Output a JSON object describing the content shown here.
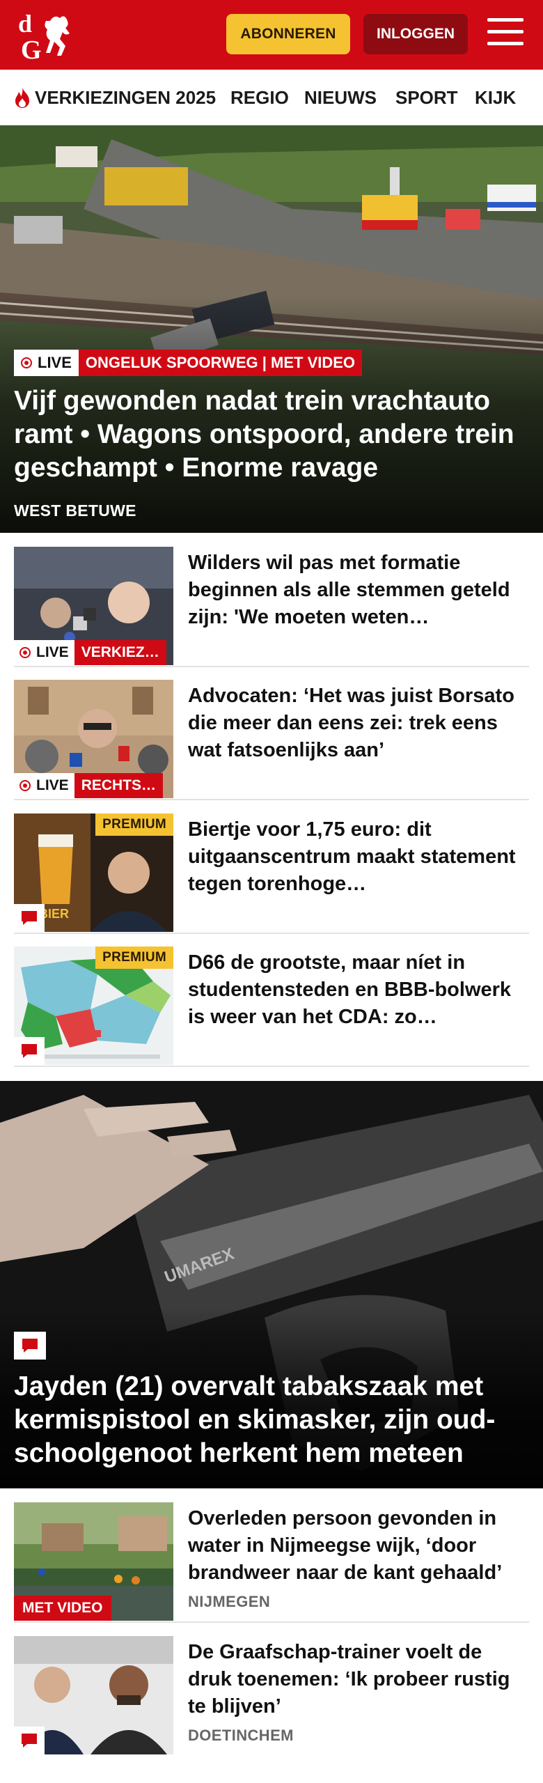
{
  "header": {
    "subscribe_label": "ABONNEREN",
    "login_label": "INLOGGEN",
    "brand_color": "#d00a14",
    "logo_letters": "dG"
  },
  "nav": {
    "items": [
      "VERKIEZINGEN 2025",
      "REGIO",
      "NIEUWS",
      "SPORT",
      "KIJK"
    ],
    "first_item_icon": "flame-icon"
  },
  "hero": {
    "live_label": "LIVE",
    "category": "ONGELUK SPOORWEG | MET VIDEO",
    "title": "Vijf gewonden nadat trein vrachtauto ramt • Wagons ontspoord, andere trein geschampt • Enorme ravage",
    "location": "WEST BETUWE"
  },
  "articles": [
    {
      "title": "Wilders wil pas met formatie beginnen als alle stemmen geteld zijn: 'We moeten weten…",
      "live_label": "LIVE",
      "category": "VERKIEZ…"
    },
    {
      "title": "Advocaten: ‘Het was juist Borsato die meer dan eens zei: trek eens wat fatsoenlijks aan’",
      "live_label": "LIVE",
      "category": "RECHTS…"
    },
    {
      "title": "Biertje voor 1,75 euro: dit uitgaanscentrum maakt statement tegen torenhoge…",
      "premium_label": "PREMIUM",
      "thumb_text": "BIER"
    },
    {
      "title": "D66 de grootste, maar níet in studentensteden en BBB-bol­werk is weer van het CDA: zo…",
      "premium_label": "PREMIUM"
    }
  ],
  "feature": {
    "title": "Jayden (21) overvalt tabakszaak met kermispistool en skimasker, zijn oud-schoolgenoot herkent hem meteen",
    "image_text": "UMAREX"
  },
  "articles_bottom": [
    {
      "title": "Overleden persoon gevonden in water in Nijmeegse wijk, ‘door brandweer naar de kant gehaald’",
      "location": "NIJMEGEN",
      "video_label": "MET VIDEO"
    },
    {
      "title": "De Graafschap-trainer voelt de druk toenemen: ‘Ik probeer rustig te blijven’",
      "location": "DOETINCHEM"
    }
  ]
}
